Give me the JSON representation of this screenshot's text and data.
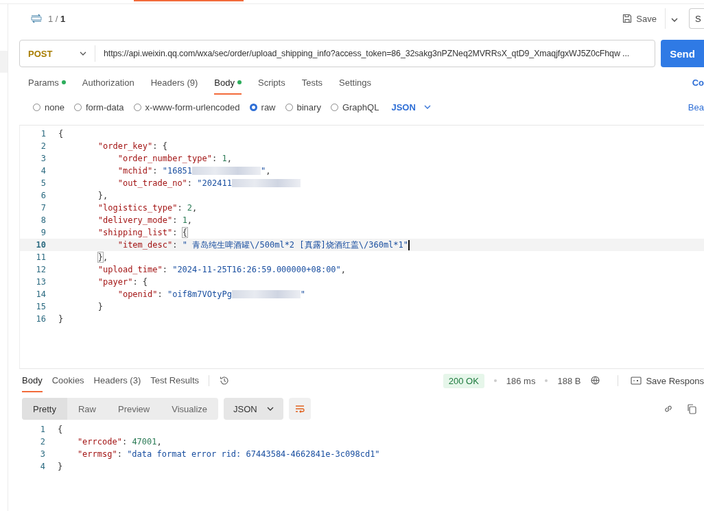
{
  "request_header": {
    "counter": "1 / ",
    "counter_total": "1",
    "save_label": "Save",
    "cut_button": "S"
  },
  "url_bar": {
    "method": "POST",
    "url": "https://api.weixin.qq.com/wxa/sec/order/upload_shipping_info?access_token=86_32sakg3nPZNeq2MVRRsX_qtD9_XmaqjfgxWJ5Z0cFhqw ...",
    "send": "Send"
  },
  "request_tabs": [
    {
      "label": "Params",
      "dot": true,
      "selected": false
    },
    {
      "label": "Authorization",
      "dot": false,
      "selected": false
    },
    {
      "label": "Headers (9)",
      "dot": false,
      "selected": false
    },
    {
      "label": "Body",
      "dot": true,
      "selected": true
    },
    {
      "label": "Scripts",
      "dot": false,
      "selected": false
    },
    {
      "label": "Tests",
      "dot": false,
      "selected": false
    },
    {
      "label": "Settings",
      "dot": false,
      "selected": false
    }
  ],
  "request_tabs_right": "Co",
  "body_types": [
    {
      "label": "none",
      "selected": false
    },
    {
      "label": "form-data",
      "selected": false
    },
    {
      "label": "x-www-form-urlencoded",
      "selected": false
    },
    {
      "label": "raw",
      "selected": true
    },
    {
      "label": "binary",
      "selected": false
    },
    {
      "label": "GraphQL",
      "selected": false
    }
  ],
  "body_format": "JSON",
  "beautify": "Bea",
  "request_body": [
    {
      "number": "1",
      "active": false,
      "tokens": [
        {
          "kind": "punct",
          "text": "{"
        }
      ],
      "children": [
        {
          "number": "2",
          "active": false,
          "tokens": [
            {
              "kind": "key",
              "text": "\"order_key\""
            },
            {
              "kind": "punct",
              "text": ": {"
            }
          ],
          "children": [
            {
              "number": "3",
              "active": false,
              "tokens": [
                {
                  "kind": "key",
                  "text": "\"order_number_type\""
                },
                {
                  "kind": "punct",
                  "text": ": "
                },
                {
                  "kind": "number",
                  "text": "1"
                },
                {
                  "kind": "punct",
                  "text": ","
                }
              ]
            },
            {
              "number": "4",
              "active": false,
              "tokens": [
                {
                  "kind": "key",
                  "text": "\"mchid\""
                },
                {
                  "kind": "punct",
                  "text": ": "
                },
                {
                  "kind": "string",
                  "text": "\"16851"
                },
                {
                  "kind": "redacted"
                },
                {
                  "kind": "string",
                  "text": "\""
                },
                {
                  "kind": "punct",
                  "text": ","
                }
              ]
            },
            {
              "number": "5",
              "active": false,
              "tokens": [
                {
                  "kind": "key",
                  "text": "\"out_trade_no\""
                },
                {
                  "kind": "punct",
                  "text": ": "
                },
                {
                  "kind": "string",
                  "text": "\"202411"
                },
                {
                  "kind": "redacted"
                }
              ]
            }
          ]
        },
        {
          "number": "6",
          "active": false,
          "tokens": [
            {
              "kind": "punct",
              "text": "},"
            }
          ]
        },
        {
          "number": "7",
          "active": false,
          "tokens": [
            {
              "kind": "key",
              "text": "\"logistics_type\""
            },
            {
              "kind": "punct",
              "text": ": "
            },
            {
              "kind": "number",
              "text": "2"
            },
            {
              "kind": "punct",
              "text": ","
            }
          ]
        },
        {
          "number": "8",
          "active": false,
          "tokens": [
            {
              "kind": "key",
              "text": "\"delivery_mode\""
            },
            {
              "kind": "punct",
              "text": ": "
            },
            {
              "kind": "number",
              "text": "1"
            },
            {
              "kind": "punct",
              "text": ","
            }
          ]
        },
        {
          "number": "9",
          "active": false,
          "tokens": [
            {
              "kind": "key",
              "text": "\"shipping_list\""
            },
            {
              "kind": "punct",
              "text": ": "
            },
            {
              "kind": "bracket",
              "text": "{"
            }
          ],
          "children": [
            {
              "number": "10",
              "active": true,
              "tokens": [
                {
                  "kind": "key",
                  "text": "\"item_desc\""
                },
                {
                  "kind": "punct",
                  "text": ": "
                },
                {
                  "kind": "string",
                  "text": "\" 青岛纯生啤酒罐\\/500ml*2 [真露]烧酒红盖\\/360ml*1\""
                }
              ]
            }
          ]
        },
        {
          "number": "11",
          "active": false,
          "tokens": [
            {
              "kind": "bracket",
              "text": "}"
            },
            {
              "kind": "punct",
              "text": ","
            }
          ]
        },
        {
          "number": "12",
          "active": false,
          "tokens": [
            {
              "kind": "key",
              "text": "\"upload_time\""
            },
            {
              "kind": "punct",
              "text": ": "
            },
            {
              "kind": "string",
              "text": "\"2024-11-25T16:26:59.000000+08:00\""
            },
            {
              "kind": "punct",
              "text": ","
            }
          ]
        },
        {
          "number": "13",
          "active": false,
          "tokens": [
            {
              "kind": "key",
              "text": "\"payer\""
            },
            {
              "kind": "punct",
              "text": ": {"
            }
          ],
          "children": [
            {
              "number": "14",
              "active": false,
              "tokens": [
                {
                  "kind": "key",
                  "text": "\"openid\""
                },
                {
                  "kind": "punct",
                  "text": ": "
                },
                {
                  "kind": "string",
                  "text": "\"oif8m7VOtyPg"
                },
                {
                  "kind": "redacted"
                },
                {
                  "kind": "string",
                  "text": "\""
                }
              ]
            }
          ]
        },
        {
          "number": "15",
          "active": false,
          "tokens": [
            {
              "kind": "punct",
              "text": "}"
            }
          ]
        }
      ]
    },
    {
      "number": "16",
      "active": false,
      "tokens": [
        {
          "kind": "punct",
          "text": "}"
        }
      ]
    }
  ],
  "response_tabs": [
    {
      "label": "Body",
      "selected": true
    },
    {
      "label": "Cookies",
      "selected": false
    },
    {
      "label": "Headers (3)",
      "selected": false
    },
    {
      "label": "Test Results",
      "selected": false
    }
  ],
  "response_meta": {
    "status": "200 OK",
    "time": "186 ms",
    "size": "188 B",
    "save_response": "Save Respons"
  },
  "view_modes": [
    {
      "label": "Pretty",
      "selected": true
    },
    {
      "label": "Raw",
      "selected": false
    },
    {
      "label": "Preview",
      "selected": false
    },
    {
      "label": "Visualize",
      "selected": false
    }
  ],
  "response_format": "JSON",
  "response_body": [
    {
      "number": "1",
      "active": false,
      "tokens": [
        {
          "kind": "punct",
          "text": "{"
        }
      ],
      "children": [
        {
          "number": "2",
          "active": false,
          "tokens": [
            {
              "kind": "key",
              "text": "\"errcode\""
            },
            {
              "kind": "punct",
              "text": ": "
            },
            {
              "kind": "number",
              "text": "47001"
            },
            {
              "kind": "punct",
              "text": ","
            }
          ]
        },
        {
          "number": "3",
          "active": false,
          "tokens": [
            {
              "kind": "key",
              "text": "\"errmsg\""
            },
            {
              "kind": "punct",
              "text": ": "
            },
            {
              "kind": "string",
              "text": "\"data format error rid: 67443584-4662841e-3c098cd1\""
            }
          ]
        }
      ]
    },
    {
      "number": "4",
      "active": false,
      "tokens": [
        {
          "kind": "punct",
          "text": "}"
        }
      ]
    }
  ]
}
